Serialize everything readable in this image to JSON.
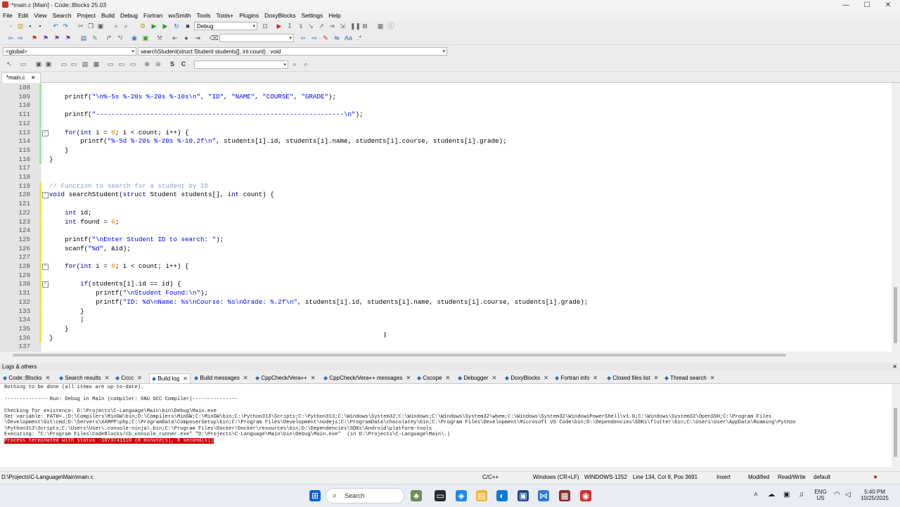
{
  "window": {
    "title": "*main.c [Main] - Code::Blocks 25.03",
    "minimize": "—",
    "maximize": "☐",
    "close": "✕"
  },
  "menu": [
    "File",
    "Edit",
    "View",
    "Search",
    "Project",
    "Build",
    "Debug",
    "Fortran",
    "wxSmith",
    "Tools",
    "Tools+",
    "Plugins",
    "DoxyBlocks",
    "Settings",
    "Help"
  ],
  "toolbar": {
    "build_target": "Debug",
    "scope": "<global>",
    "function": "searchStudent(struct Student students[], int count) : void"
  },
  "editor_tab": {
    "label": "*main.c",
    "close": "✕"
  },
  "code_lines": [
    {
      "n": "108",
      "t": "",
      "fold": ""
    },
    {
      "n": "109",
      "t": "    printf(\"\\n%-5s %-20s %-20s %-10s\\n\", \"ID\", \"NAME\", \"COURSE\", \"GRADE\");",
      "fold": ""
    },
    {
      "n": "110",
      "t": "",
      "fold": ""
    },
    {
      "n": "111",
      "t": "    printf(\"----------------------------------------------------------------\\n\");",
      "fold": ""
    },
    {
      "n": "112",
      "t": "",
      "fold": ""
    },
    {
      "n": "113",
      "t": "    for(int i = 0; i < count; i++) {",
      "fold": "−"
    },
    {
      "n": "114",
      "t": "        printf(\"%-5d %-20s %-20s %-10.2f\\n\", students[i].id, students[i].name, students[i].course, students[i].grade);",
      "fold": ""
    },
    {
      "n": "115",
      "t": "    }",
      "fold": ""
    },
    {
      "n": "116",
      "t": "}",
      "fold": ""
    },
    {
      "n": "117",
      "t": "",
      "fold": ""
    },
    {
      "n": "118",
      "t": "",
      "fold": ""
    },
    {
      "n": "119",
      "t": "// Function to search for a student by ID",
      "fold": ""
    },
    {
      "n": "120",
      "t": "void searchStudent(struct Student students[], int count) {",
      "fold": "−"
    },
    {
      "n": "121",
      "t": "",
      "fold": ""
    },
    {
      "n": "122",
      "t": "    int id;",
      "fold": ""
    },
    {
      "n": "123",
      "t": "    int found = 0;",
      "fold": ""
    },
    {
      "n": "124",
      "t": "",
      "fold": ""
    },
    {
      "n": "125",
      "t": "    printf(\"\\nEnter Student ID to search: \");",
      "fold": ""
    },
    {
      "n": "126",
      "t": "    scanf(\"%d\", &id);",
      "fold": ""
    },
    {
      "n": "127",
      "t": "",
      "fold": ""
    },
    {
      "n": "128",
      "t": "    for(int i = 0; i < count; i++) {",
      "fold": "−"
    },
    {
      "n": "129",
      "t": "",
      "fold": ""
    },
    {
      "n": "130",
      "t": "        if(students[i].id == id) {",
      "fold": "−"
    },
    {
      "n": "131",
      "t": "            printf(\"\\nStudent Found:\\n\");",
      "fold": ""
    },
    {
      "n": "132",
      "t": "            printf(\"ID: %d\\nName: %s\\nCourse: %s\\nGrade: %.2f\\n\", students[i].id, students[i].name, students[i].course, students[i].grade);",
      "fold": ""
    },
    {
      "n": "133",
      "t": "        }",
      "fold": ""
    },
    {
      "n": "134",
      "t": "        |",
      "fold": ""
    },
    {
      "n": "135",
      "t": "    }",
      "fold": ""
    },
    {
      "n": "136",
      "t": "}",
      "fold": ""
    },
    {
      "n": "137",
      "t": "",
      "fold": ""
    }
  ],
  "logs": {
    "header": "Logs & others",
    "tabs": [
      "Code::Blocks",
      "Search results",
      "Cccc",
      "Build log",
      "Build messages",
      "CppCheck/Vera++",
      "CppCheck/Vera++ messages",
      "Cscope",
      "Debugger",
      "DoxyBlocks",
      "Fortran info",
      "Closed files list",
      "Thread search"
    ],
    "lines": [
      "Nothing to be done (all items are up-to-date).",
      "",
      "-------------- Run: Debug in Main (compiler: GNU GCC Compiler)---------------",
      "",
      "Checking for existence: D:\\Projects\\C-Language\\Main\\bin\\Debug\\Main.exe",
      "Set variable: PATH=.;D:\\Compilers\\MinGW\\bin;D:\\Compilers\\MinGW;C:\\MinGW\\bin;C:\\Python313\\Scripts;C:\\Python313;C:\\Windows\\System32;C:\\Windows;C:\\Windows\\System32\\wbem;C:\\Windows\\System32\\WindowsPowerShell\\v1.0;C:\\Windows\\System32\\OpenSSH;C:\\Program Files",
      "\\Development\\Git\\cmd;D:\\Servers\\XAMPP\\php;C:\\ProgramData\\ComposerSetup\\bin;C:\\Program Files\\Development\\nodejs;C:\\ProgramData\\chocolatey\\bin;C:\\Program Files\\Development\\Microsoft VS Code\\bin;D:\\Dependencies\\SDKs\\flutter\\bin;C:\\Users\\User\\AppData\\Roaming\\Python",
      "\\Python313\\Scripts;C:\\Users\\User\\.console-ninja\\.bin;C:\\Program Files\\Docker\\Docker\\resources\\bin;D:\\Dependencies\\SDKs\\Android\\platform-tools",
      "Executing: \"C:\\Program Files\\CodeBlocks/cb_console_runner.exe\" \"D:\\Projects\\C-Language\\Main\\bin\\Debug\\Main.exe\"  (in D:\\Projects\\C-Language\\Main\\.)"
    ],
    "error": "Process terminated with status -1073741510 (0 minute(s), 8 second(s))"
  },
  "status": {
    "path": "D:\\Projects\\C-Language\\Main\\main.c",
    "language": "C/C++",
    "eol": "Windows (CR+LF)",
    "encoding": "WINDOWS-1252",
    "position": "Line 134, Col 9, Pos 3691",
    "insert": "Insert",
    "modified": "Modified",
    "rw": "Read/Write",
    "profile": "default"
  },
  "taskbar": {
    "search": "Search",
    "lang_top": "ENG",
    "lang_bottom": "US",
    "time": "5:40 PM",
    "date": "10/25/2025"
  }
}
